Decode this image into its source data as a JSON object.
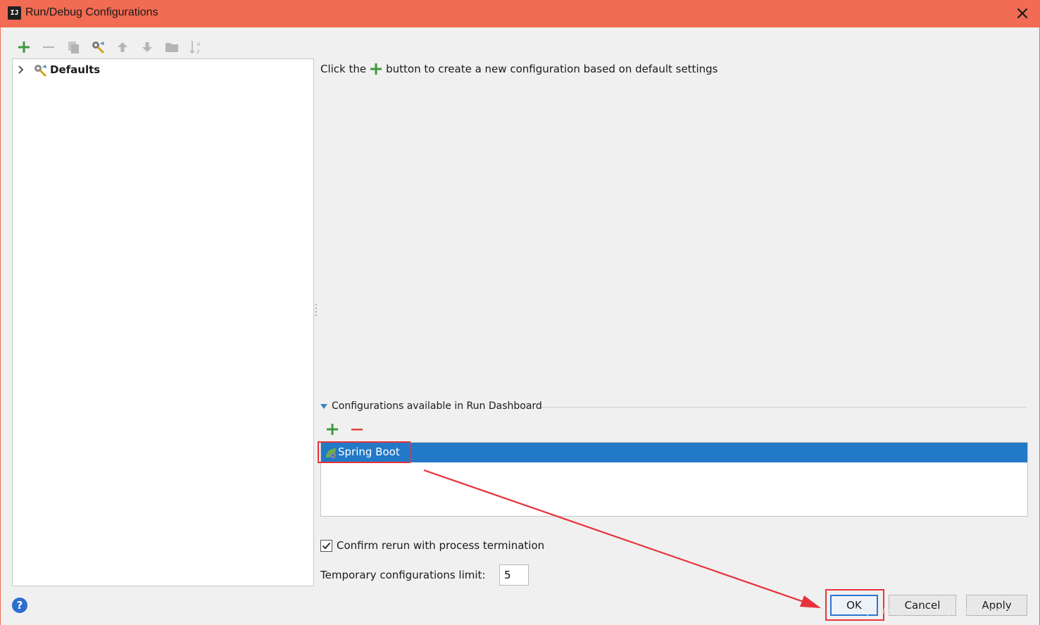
{
  "window": {
    "title": "Run/Debug Configurations",
    "app_icon_text": "IJ",
    "titlebar_color": "#f26b53"
  },
  "toolbar": {
    "items": [
      {
        "name": "add-icon",
        "enabled": true,
        "color": "#3c9a3c"
      },
      {
        "name": "remove-icon",
        "enabled": false
      },
      {
        "name": "copy-icon",
        "enabled": false
      },
      {
        "name": "edit-defaults-icon",
        "enabled": true
      },
      {
        "name": "move-up-icon",
        "enabled": false
      },
      {
        "name": "move-down-icon",
        "enabled": false
      },
      {
        "name": "folder-icon",
        "enabled": false
      },
      {
        "name": "sort-icon",
        "enabled": false
      }
    ]
  },
  "tree": {
    "items": [
      {
        "label": "Defaults",
        "icon": "wrench-gear-icon",
        "expanded": false
      }
    ]
  },
  "hint": {
    "before": "Click the",
    "after": "button to create a new configuration based on default settings"
  },
  "run_dashboard": {
    "title": "Configurations available in Run Dashboard",
    "expanded": true,
    "items": [
      {
        "label": "Spring Boot",
        "selected": true,
        "icon": "spring-boot-icon"
      }
    ],
    "selection_color": "#2279c7"
  },
  "options": {
    "confirm_rerun_label": "Confirm rerun with process termination",
    "confirm_rerun_checked": true,
    "temp_limit_label": "Temporary configurations limit:",
    "temp_limit_value": "5"
  },
  "buttons": {
    "help": "?",
    "ok": "OK",
    "cancel": "Cancel",
    "apply": "Apply"
  },
  "annotations": {
    "highlight_color": "#e8323b"
  },
  "watermark": "https://blog.csdn.net/yr1684876859"
}
